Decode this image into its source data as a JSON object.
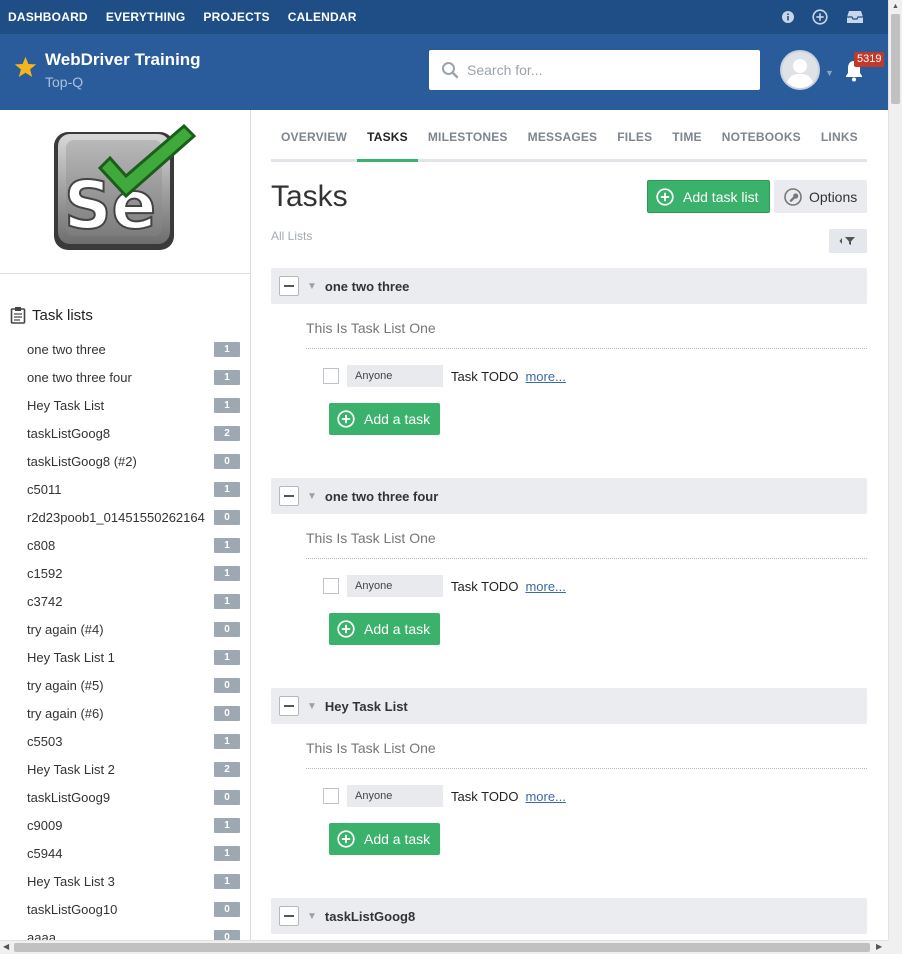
{
  "topnav": {
    "items": [
      "DASHBOARD",
      "EVERYTHING",
      "PROJECTS",
      "CALENDAR"
    ],
    "icons": [
      "info-icon",
      "plus-circle-icon",
      "inbox-icon"
    ]
  },
  "header": {
    "project_title": "WebDriver Training",
    "company": "Top-Q",
    "search_placeholder": "Search for...",
    "notification_count": "5319"
  },
  "sidebar": {
    "heading": "Task lists",
    "items": [
      {
        "name": "one two three",
        "count": "1"
      },
      {
        "name": "one two three four",
        "count": "1"
      },
      {
        "name": "Hey Task List",
        "count": "1"
      },
      {
        "name": "taskListGoog8",
        "count": "2"
      },
      {
        "name": "taskListGoog8 (#2)",
        "count": "0"
      },
      {
        "name": "c5011",
        "count": "1"
      },
      {
        "name": "r2d23poob1_01451550262164",
        "count": "0"
      },
      {
        "name": "c808",
        "count": "1"
      },
      {
        "name": "c1592",
        "count": "1"
      },
      {
        "name": "c3742",
        "count": "1"
      },
      {
        "name": "try again (#4)",
        "count": "0"
      },
      {
        "name": "Hey Task List 1",
        "count": "1"
      },
      {
        "name": "try again (#5)",
        "count": "0"
      },
      {
        "name": "try again (#6)",
        "count": "0"
      },
      {
        "name": "c5503",
        "count": "1"
      },
      {
        "name": "Hey Task List 2",
        "count": "2"
      },
      {
        "name": "taskListGoog9",
        "count": "0"
      },
      {
        "name": "c9009",
        "count": "1"
      },
      {
        "name": "c5944",
        "count": "1"
      },
      {
        "name": "Hey Task List 3",
        "count": "1"
      },
      {
        "name": "taskListGoog10",
        "count": "0"
      },
      {
        "name": "aaaa",
        "count": "0"
      }
    ]
  },
  "tabs": [
    "OVERVIEW",
    "TASKS",
    "MILESTONES",
    "MESSAGES",
    "FILES",
    "TIME",
    "NOTEBOOKS",
    "LINKS"
  ],
  "active_tab": "TASKS",
  "main": {
    "title": "Tasks",
    "filter_label": "All Lists",
    "add_list_label": "Add task list",
    "options_label": "Options",
    "tasklists": [
      {
        "title": "one two three",
        "description": "This Is Task List One",
        "assignee": "Anyone",
        "task": "Task TODO",
        "more": "more...",
        "add_task": "Add a task"
      },
      {
        "title": "one two three four",
        "description": "This Is Task List One",
        "assignee": "Anyone",
        "task": "Task TODO",
        "more": "more...",
        "add_task": "Add a task"
      },
      {
        "title": "Hey Task List",
        "description": "This Is Task List One",
        "assignee": "Anyone",
        "task": "Task TODO",
        "more": "more...",
        "add_task": "Add a task"
      },
      {
        "title": "taskListGoog8"
      }
    ]
  },
  "colors": {
    "topnav_bg": "#1f4e87",
    "header_bg": "#2a5b9a",
    "accent_green": "#3bb26b",
    "badge_red": "#c0392b",
    "count_badge": "#9ea8b3"
  }
}
